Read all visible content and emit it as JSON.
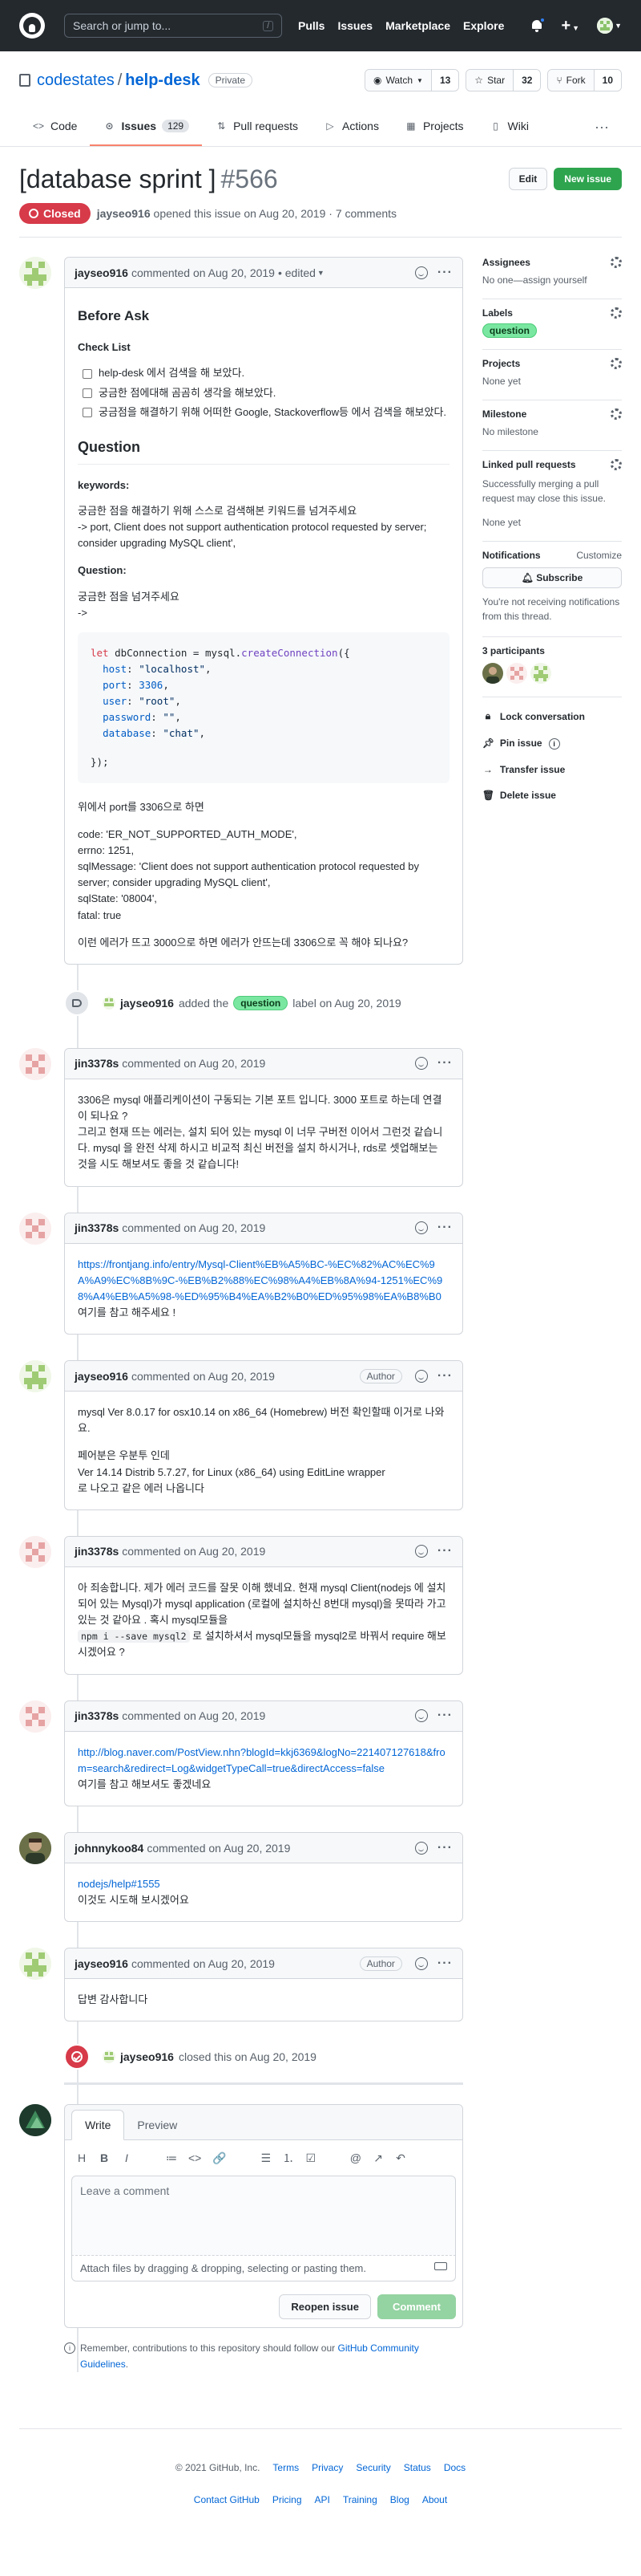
{
  "header": {
    "search_placeholder": "Search or jump to...",
    "search_key": "/",
    "nav": [
      "Pulls",
      "Issues",
      "Marketplace",
      "Explore"
    ]
  },
  "repo": {
    "owner": "codestates",
    "name": "help-desk",
    "visibility": "Private",
    "watch_label": "Watch",
    "watch_count": "13",
    "star_label": "Star",
    "star_count": "32",
    "fork_label": "Fork",
    "fork_count": "10",
    "tabs": [
      {
        "label": "Code",
        "icon": "code-icon"
      },
      {
        "label": "Issues",
        "icon": "issue-icon",
        "count": "129"
      },
      {
        "label": "Pull requests",
        "icon": "pull-request-icon"
      },
      {
        "label": "Actions",
        "icon": "play-icon"
      },
      {
        "label": "Projects",
        "icon": "project-icon"
      },
      {
        "label": "Wiki",
        "icon": "book-icon"
      }
    ]
  },
  "issue": {
    "title": "[database sprint ]",
    "number": "#566",
    "edit_label": "Edit",
    "new_issue_label": "New issue",
    "state": "Closed",
    "author": "jayseo916",
    "meta_text": "opened this issue on Aug 20, 2019 · 7 comments"
  },
  "colors": {
    "closed": "#d73a49",
    "primary": "#2ea44f",
    "link": "#0366d6",
    "active_tab": "#f9826c"
  },
  "first_comment": {
    "author": "jayseo916",
    "action": "commented on Aug 20, 2019",
    "edited": "• edited",
    "before_ask": "Before Ask",
    "check_list": "Check List",
    "tasks": [
      "help-desk 에서 검색을 해 보았다.",
      "궁금한 점에대해 곰곰히 생각을 해보았다.",
      "궁금점을 해결하기 위해 어떠한 Google, Stackoverflow등 에서 검색을 해보았다."
    ],
    "question_h": "Question",
    "keywords_h": "keywords:",
    "keywords_1": "궁금한 점을 해결하기 위해 스스로 검색해본 키워드를 넘겨주세요",
    "keywords_2": "-> port, Client does not support authentication protocol requested by server; consider upgrading MySQL client',",
    "question_label": "Question:",
    "question_1": "궁금한 점을 넘겨주세요",
    "question_2": "->",
    "code": {
      "l1_kw": "let",
      "l1_var": " dbConnection = mysql.",
      "l1_fn": "createConnection",
      "l1_end": "({",
      "l2_key": "host",
      "l2_val": "\"localhost\"",
      "l3_key": "port",
      "l3_val": "3306",
      "l4_key": "user",
      "l4_val": "\"root\"",
      "l5_key": "password",
      "l5_val": "\"\"",
      "l6_key": "database",
      "l6_val": "\"chat\"",
      "l7": "});"
    },
    "after_code": "위에서 port를 3306으로 하면",
    "error_lines": [
      "code: 'ER_NOT_SUPPORTED_AUTH_MODE',",
      "errno: 1251,",
      "sqlMessage: 'Client does not support authentication protocol requested by server; consider upgrading MySQL client',",
      "sqlState: '08004',",
      "fatal: true"
    ],
    "final_q": "이런 에러가 뜨고 3000으로 하면 에러가 안뜨는데 3306으로 꼭 해야 되나요?"
  },
  "label_event": {
    "actor": "jayseo916",
    "pre": "added the",
    "label": "question",
    "post": "label on Aug 20, 2019"
  },
  "comments": [
    {
      "author": "jin3378s",
      "action": "commented on Aug 20, 2019",
      "lines": [
        "3306은 mysql 애플리케이션이 구동되는 기본 포트 입니다. 3000 포트로 하는데 연결이 되나요 ?",
        "그리고 현재 뜨는 에러는, 설치 되어 있는 mysql 이 너무 구버전 이어서 그런것 같습니다. mysql 을 완전 삭제 하시고 비교적 최신 버전을 설치 하시거나, rds로 셋업해보는 것을 시도 해보셔도 좋을 것 같습니다!"
      ]
    },
    {
      "author": "jin3378s",
      "action": "commented on Aug 20, 2019",
      "link": "https://frontjang.info/entry/Mysql-Client%EB%A5%BC-%EC%82%AC%EC%9A%A9%EC%8B%9C-%EB%B2%88%EC%98%A4%EB%8A%94-1251%EC%98%A4%EB%A5%98-%ED%95%B4%EA%B2%B0%ED%95%98%EA%B8%B0",
      "text": "여기를 참고 해주세요 !"
    },
    {
      "author": "jayseo916",
      "action": "commented on Aug 20, 2019",
      "badge": "Author",
      "p1": "mysql Ver 8.0.17 for osx10.14 on x86_64 (Homebrew) 버전 확인할때 이거로 나와요.",
      "p2a": "페어분은 우분투 인데",
      "p2b": "Ver 14.14 Distrib 5.7.27, for Linux (x86_64) using EditLine wrapper",
      "p2c": "로 나오고 같은 에러 나옵니다"
    },
    {
      "author": "jin3378s",
      "action": "commented on Aug 20, 2019",
      "t1": "아 죄송합니다. 제가 에러 코드를 잘못 이해 했네요. 현재 mysql Client(nodejs 에 설치 되어 있는 Mysql)가 mysql application (로컬에 설치하신 8번대 mysql)을 못따라 가고 있는 것 같아요 . 혹시 mysql모듈을",
      "code": "npm i --save mysql2",
      "t2": " 로 설치하셔서 mysql모듈을 mysql2로 바꿔서 require 해보시겠어요 ?"
    },
    {
      "author": "jin3378s",
      "action": "commented on Aug 20, 2019",
      "link": "http://blog.naver.com/PostView.nhn?blogId=kkj6369&logNo=221407127618&from=search&redirect=Log&widgetTypeCall=true&directAccess=false",
      "text": "여기를 참고 해보셔도 좋겠네요"
    },
    {
      "author": "johnnykoo84",
      "action": "commented on Aug 20, 2019",
      "link": "nodejs/help#1555",
      "text": "이것도 시도해 보시겠어요"
    },
    {
      "author": "jayseo916",
      "action": "commented on Aug 20, 2019",
      "badge": "Author",
      "text": "답변 감사합니다"
    }
  ],
  "close_event": {
    "actor": "jayseo916",
    "text": "closed this on Aug 20, 2019"
  },
  "new_comment": {
    "tab_write": "Write",
    "tab_preview": "Preview",
    "placeholder": "Leave a comment",
    "attach_text": "Attach files by dragging & dropping, selecting or pasting them.",
    "reopen_label": "Reopen issue",
    "comment_label": "Comment",
    "toolbar": [
      "H",
      "B",
      "I",
      "≔",
      "<>",
      "🔗",
      "☰",
      "⒈",
      "☑",
      "@",
      "↗",
      "↶"
    ]
  },
  "remember": {
    "pre": "Remember, contributions to this repository should follow our",
    "link": "GitHub Community Guidelines",
    "post": "."
  },
  "sidebar": {
    "assignees_h": "Assignees",
    "assignees_v": "No one—assign yourself",
    "labels_h": "Labels",
    "labels_v": "question",
    "projects_h": "Projects",
    "projects_v": "None yet",
    "milestone_h": "Milestone",
    "milestone_v": "No milestone",
    "linked_h": "Linked pull requests",
    "linked_v": "Successfully merging a pull request may close this issue.",
    "linked_v2": "None yet",
    "notif_h": "Notifications",
    "notif_customize": "Customize",
    "subscribe": "Subscribe",
    "notif_text": "You're not receiving notifications from this thread.",
    "participants_h": "3 participants",
    "actions": [
      "Lock conversation",
      "Pin issue",
      "Transfer issue",
      "Delete issue"
    ]
  },
  "footer": {
    "copyright": "© 2021 GitHub, Inc.",
    "links": [
      "Terms",
      "Privacy",
      "Security",
      "Status",
      "Docs",
      "Contact GitHub",
      "Pricing",
      "API",
      "Training",
      "Blog",
      "About"
    ]
  }
}
